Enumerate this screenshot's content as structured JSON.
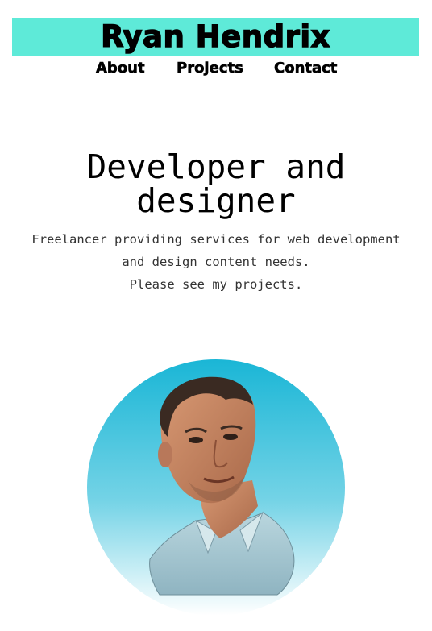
{
  "header": {
    "title": "Ryan Hendrix",
    "accent_color": "#5eead8"
  },
  "nav": {
    "items": [
      "About",
      "Projects",
      "Contact"
    ]
  },
  "hero": {
    "headline_line1": "Developer and",
    "headline_line2": "designer",
    "tagline_line1": "Freelancer providing services for web development",
    "tagline_line2": "and design content needs.",
    "tagline_line3": "Please see my projects."
  },
  "portrait": {
    "icon": "profile-photo",
    "gradient_top": "#1ab6d6",
    "gradient_bottom": "#ffffff"
  }
}
